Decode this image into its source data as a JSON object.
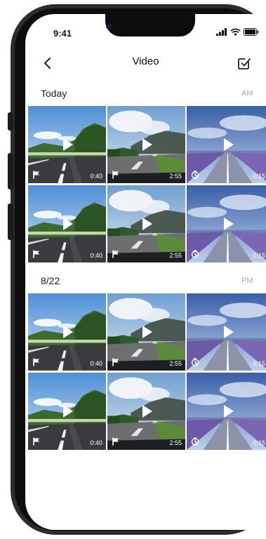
{
  "status_bar": {
    "time": "9:41"
  },
  "header": {
    "title": "Video"
  },
  "sections": [
    {
      "label": "Today",
      "period": "AM",
      "items": [
        {
          "scene": "highway",
          "tag": "flag-icon",
          "duration": "0:40"
        },
        {
          "scene": "windshield",
          "tag": "flag-icon",
          "duration": "2:55"
        },
        {
          "scene": "timelapse-road",
          "tag": "timer-icon",
          "duration": "0:15"
        },
        {
          "scene": "highway",
          "tag": "flag-icon",
          "duration": "0:40"
        },
        {
          "scene": "windshield",
          "tag": "flag-icon",
          "duration": "2:55"
        },
        {
          "scene": "timelapse-road",
          "tag": "timer-icon",
          "duration": "0:15"
        }
      ]
    },
    {
      "label": "8/22",
      "period": "PM",
      "items": [
        {
          "scene": "highway",
          "tag": "flag-icon",
          "duration": "0:40"
        },
        {
          "scene": "windshield",
          "tag": "flag-icon",
          "duration": "2:55"
        },
        {
          "scene": "timelapse-road",
          "tag": "timer-icon",
          "duration": "0:15"
        },
        {
          "scene": "highway",
          "tag": "flag-icon",
          "duration": "0:40"
        },
        {
          "scene": "windshield",
          "tag": "flag-icon",
          "duration": "2:55"
        },
        {
          "scene": "timelapse-road",
          "tag": "timer-icon",
          "duration": "0:15"
        }
      ]
    }
  ]
}
